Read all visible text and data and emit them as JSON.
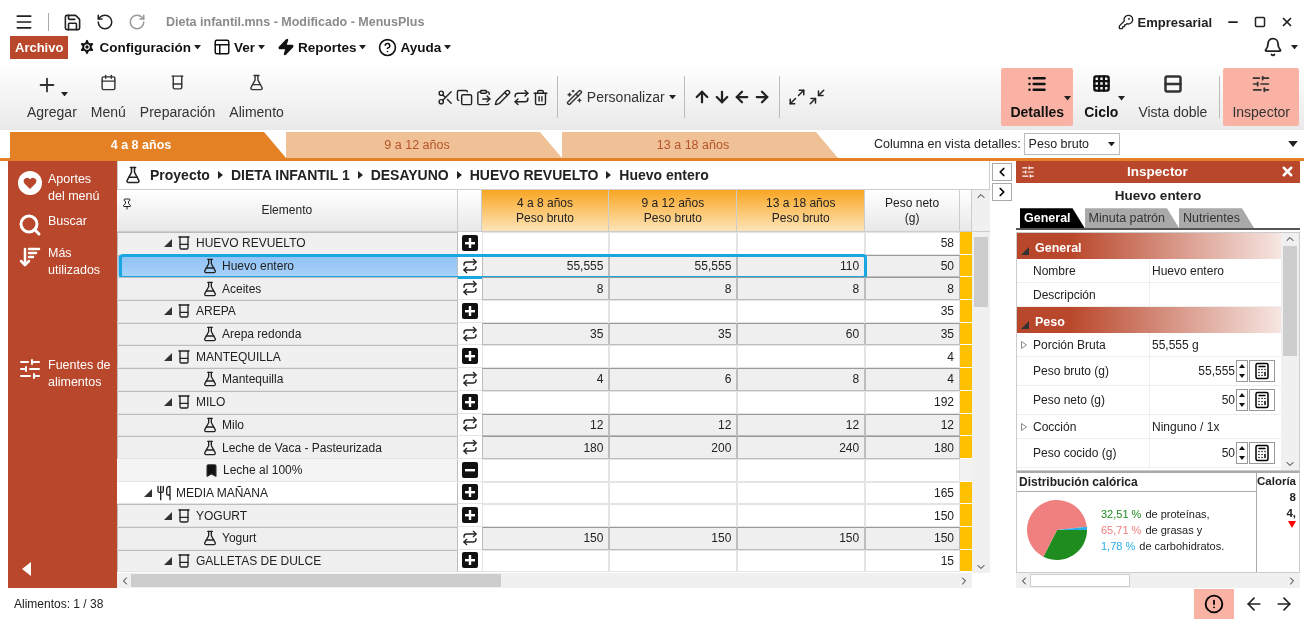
{
  "title_bar": {
    "title": "Dieta infantil.mns - Modificado - MenusPlus",
    "license": "Empresarial"
  },
  "menu": [
    {
      "label": "Archivo",
      "kind": "file"
    },
    {
      "label": "Configuración",
      "kind": "dropdown"
    },
    {
      "label": "Ver",
      "kind": "dropdown"
    },
    {
      "label": "Reportes",
      "kind": "dropdown"
    },
    {
      "label": "Ayuda",
      "kind": "dropdown"
    }
  ],
  "ribbon": {
    "insert": [
      {
        "label": "Agregar",
        "caret": true
      },
      {
        "label": "Menú",
        "caret": false
      },
      {
        "label": "Preparación",
        "caret": false
      },
      {
        "label": "Alimento",
        "caret": false
      }
    ],
    "customize": {
      "label": "Personalizar"
    },
    "views": [
      {
        "label": "Detalles",
        "selected": true,
        "bold": true,
        "caret": true
      },
      {
        "label": "Ciclo",
        "selected": false,
        "bold": true,
        "caret": true
      },
      {
        "label": "Vista doble",
        "selected": false,
        "bold": false,
        "caret": false
      },
      {
        "label": "Inspector",
        "selected": true,
        "bold": false,
        "caret": false
      }
    ]
  },
  "age_tabs": [
    {
      "label": "4 a 8 años",
      "selected": true
    },
    {
      "label": "9 a 12 años",
      "selected": false
    },
    {
      "label": "13 a 18 años",
      "selected": false
    }
  ],
  "column_picker": {
    "label": "Columna en vista detalles:",
    "value": "Peso bruto"
  },
  "sidebar": {
    "items": [
      {
        "label": "Aportes\ndel menú"
      },
      {
        "label": "Buscar"
      },
      {
        "label": "Más\nutilizados"
      },
      {
        "label": "Fuentes de\nalimentos"
      }
    ]
  },
  "breadcrumb": [
    "Proyecto",
    "DIETA INFANTIL 1",
    "DESAYUNO",
    "HUEVO REVUELTO",
    "Huevo entero"
  ],
  "grid": {
    "columns": [
      {
        "title": "Elemento",
        "highlighted": false
      },
      {
        "title": "4 a 8 años",
        "subtitle": "Peso bruto",
        "highlighted": true
      },
      {
        "title": "9 a 12 años",
        "subtitle": "Peso bruto",
        "highlighted": true
      },
      {
        "title": "13 a 18 años",
        "subtitle": "Peso bruto",
        "highlighted": true
      },
      {
        "title": "Peso neto",
        "subtitle": "(g)",
        "highlighted": false
      }
    ],
    "rows": [
      {
        "kind": "recipe",
        "name": "HUEVO REVUELTO",
        "expanded": true,
        "selected": false,
        "neto": "58",
        "children": [
          {
            "kind": "food",
            "name": "Huevo entero",
            "selected": true,
            "values": [
              "55,555",
              "55,555",
              "110"
            ],
            "neto": "50"
          },
          {
            "kind": "food",
            "name": "Aceites",
            "selected": false,
            "values": [
              "8",
              "8",
              "8"
            ],
            "neto": "8"
          }
        ]
      },
      {
        "kind": "recipe",
        "name": "AREPA",
        "expanded": true,
        "selected": false,
        "neto": "35",
        "children": [
          {
            "kind": "food",
            "name": "Arepa redonda",
            "selected": false,
            "values": [
              "35",
              "35",
              "60"
            ],
            "neto": "35"
          }
        ]
      },
      {
        "kind": "recipe",
        "name": "MANTEQUILLA",
        "expanded": true,
        "selected": false,
        "neto": "4",
        "children": [
          {
            "kind": "food",
            "name": "Mantequilla",
            "selected": false,
            "values": [
              "4",
              "6",
              "8"
            ],
            "neto": "4"
          }
        ]
      },
      {
        "kind": "recipe",
        "name": "MILO",
        "expanded": true,
        "selected": false,
        "neto": "192",
        "children": [
          {
            "kind": "food",
            "name": "Milo",
            "selected": false,
            "values": [
              "12",
              "12",
              "12"
            ],
            "neto": "12"
          },
          {
            "kind": "food",
            "name": "Leche de Vaca - Pasteurizada",
            "selected": false,
            "values": [
              "180",
              "200",
              "240"
            ],
            "neto": "180"
          },
          {
            "kind": "note",
            "name": "Leche al 100%",
            "selected": false
          }
        ]
      },
      {
        "kind": "meal",
        "name": "MEDIA MAÑANA",
        "expanded": true,
        "selected": false,
        "neto": "165",
        "children": [
          {
            "kind": "recipe",
            "name": "YOGURT",
            "expanded": true,
            "selected": false,
            "neto": "150",
            "children": [
              {
                "kind": "food",
                "name": "Yogurt",
                "selected": false,
                "values": [
                  "150",
                  "150",
                  "150"
                ],
                "neto": "150"
              }
            ]
          },
          {
            "kind": "recipe",
            "name": "GALLETAS DE DULCE",
            "expanded": true,
            "selected": false,
            "neto": "15"
          }
        ]
      }
    ]
  },
  "inspector": {
    "title": "Inspector",
    "item": "Huevo entero",
    "tabs": [
      {
        "label": "General",
        "selected": true
      },
      {
        "label": "Minuta patrón",
        "selected": false
      },
      {
        "label": "Nutrientes",
        "selected": false
      }
    ],
    "sections": [
      {
        "title": "General",
        "expanded": true,
        "properties": [
          {
            "kind": "text",
            "name": "Nombre",
            "value": "Huevo entero",
            "expandable": false
          },
          {
            "kind": "text",
            "name": "Descripción",
            "expandable": false
          }
        ]
      },
      {
        "title": "Peso",
        "expanded": true,
        "properties": [
          {
            "kind": "text",
            "name": "Porción Bruta",
            "value": "55,555 g",
            "expandable": true
          },
          {
            "kind": "number",
            "name": "Peso bruto (g)",
            "value": "55,555",
            "expandable": false
          },
          {
            "kind": "number",
            "name": "Peso neto (g)",
            "value": "50",
            "expandable": false
          },
          {
            "kind": "text",
            "name": "Cocción",
            "value": "Ninguno / 1x",
            "expandable": true
          },
          {
            "kind": "number",
            "name": "Peso cocido (g)",
            "value": "50",
            "expandable": false
          }
        ]
      }
    ],
    "distribution": {
      "title": "Distribución calórica",
      "lines": [
        {
          "value": "32,51",
          "unit": "%",
          "text": "de proteínas,",
          "color": "#1e8c1e"
        },
        {
          "value": "65,71",
          "unit": "%",
          "text": "de grasas y",
          "color": "#f08080"
        },
        {
          "value": "1,78",
          "unit": "%",
          "text": "de carbohidratos.",
          "color": "#29aee8"
        }
      ],
      "chart_data": {
        "type": "pie",
        "values": [
          32.51,
          65.71,
          1.78
        ]
      }
    },
    "calories": {
      "title": "Caloría",
      "lines": [
        "8",
        "4,"
      ]
    }
  },
  "status": {
    "text": "Alimentos: 1 / 38"
  }
}
